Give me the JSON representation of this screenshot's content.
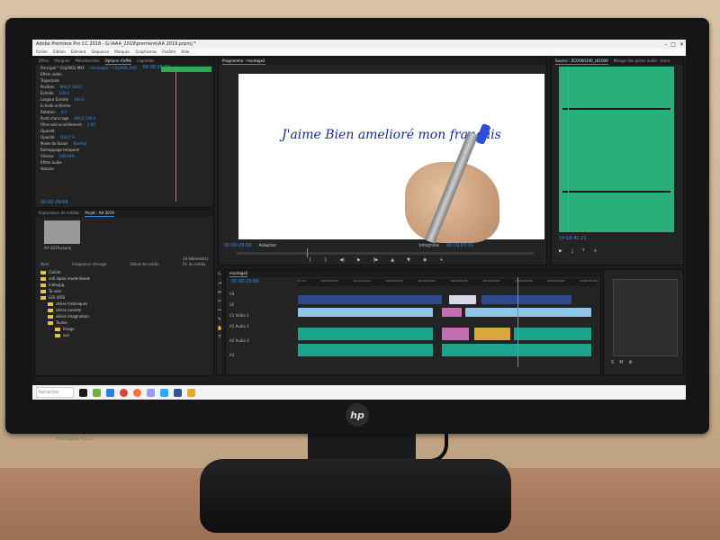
{
  "window": {
    "title": "Adobe Premiere Pro CC 2018 - G:\\AAA_2019\\premiere\\AA 2019.prproj *",
    "controls": [
      "–",
      "□",
      "✕"
    ]
  },
  "menu": [
    "Fichier",
    "Edition",
    "Elément",
    "Séquence",
    "Marques",
    "Graphismes",
    "Fenêtre",
    "Aide"
  ],
  "effect_controls": {
    "tabs": [
      "Effets",
      "Marques",
      "Métadonnées",
      "Options d'effet",
      "Légendes"
    ],
    "active_tab": "Options d'effet",
    "clip_label": "Principal * Clip0001.MXF",
    "seq_label": "montage2 * Clip0001.MXF",
    "timecode_start": "00:00:15:00",
    "section_video": "Effets vidéo",
    "rows": [
      {
        "label": "Trajectoire",
        "value": ""
      },
      {
        "label": "Position",
        "value": "960,0   540,0"
      },
      {
        "label": "Echelle",
        "value": "100,0"
      },
      {
        "label": "Largeur Echelle",
        "value": "100,0"
      },
      {
        "label": "Echelle uniforme",
        "value": ""
      },
      {
        "label": "Rotation",
        "value": "0,0"
      },
      {
        "label": "Point d'ancrage",
        "value": "960,0   540,0"
      },
      {
        "label": "Filtre anti-scintillement",
        "value": "0,00"
      },
      {
        "label": "Opacité",
        "value": ""
      },
      {
        "label": "Opacité",
        "value": "100,0 %"
      },
      {
        "label": "Mode de fusion",
        "value": "Normal"
      },
      {
        "label": "Remappage temporel",
        "value": ""
      },
      {
        "label": "Vitesse",
        "value": "100,00%"
      },
      {
        "label": "Effets audio",
        "value": ""
      },
      {
        "label": "Volume",
        "value": ""
      }
    ],
    "current_time": "00:00:29:06"
  },
  "program_monitor": {
    "tab_label": "Programme : montage2",
    "handwritten_text": "J'aime Bien amelioré mon français",
    "timecode_left": "00:00:29:06",
    "fit_label": "Adapter",
    "quality_label": "Intégrale",
    "timecode_right": "00:19:03:01"
  },
  "source_monitor": {
    "tabs": [
      "Source : ZCO060330_LK1000",
      "Mixage des pistes audio : mont"
    ],
    "timecode": "14:18:41:21",
    "wave_color": "#2bb07d"
  },
  "project_panel": {
    "tabs": [
      "Explorateur de médias",
      "Projet : AA 2019"
    ],
    "project_file": "AA 2019.prproj",
    "item_count": "24 élément(s)",
    "columns": [
      "Nom",
      "Fréquence d'image",
      "Début du média",
      "Fin du média"
    ],
    "items": [
      {
        "label": "Civilim",
        "indent": 0
      },
      {
        "label": "vidi alpha modernbook",
        "indent": 0
      },
      {
        "label": "Indexjpg",
        "indent": 0
      },
      {
        "label": "Ta voie",
        "indent": 0
      },
      {
        "label": "LES VIDS",
        "indent": 0
      },
      {
        "label": "séries historiques",
        "indent": 1
      },
      {
        "label": "séries ouverts",
        "indent": 1
      },
      {
        "label": "séries imagination",
        "indent": 1
      },
      {
        "label": "Toutes",
        "indent": 1
      },
      {
        "label": "Image",
        "indent": 2
      },
      {
        "label": "son",
        "indent": 2
      }
    ]
  },
  "timeline": {
    "tab_label": "montage2",
    "timecode": "00:00:29:06",
    "ruler_marks": [
      "00:00",
      "00:00:05:00",
      "00:00:10:00",
      "00:00:15:00",
      "00:00:20:00",
      "00:00:25:00",
      "00:00:30:00",
      "00:00:35:00",
      "00:00:40:00",
      "00:00:45:00"
    ],
    "tracks": [
      "V3",
      "V2",
      "V1",
      "A1",
      "A2",
      "A3"
    ],
    "track_names": [
      "Vidéo 1",
      "Audio 1",
      "Audio 2"
    ]
  },
  "taskbar": {
    "search_placeholder": "Rechercher",
    "icons": [
      "start-icon",
      "netflix-icon",
      "app-icon",
      "chrome-icon",
      "firefox-icon",
      "explorer-icon",
      "premiere-icon",
      "photoshop-icon",
      "word-icon"
    ]
  },
  "monitor": {
    "brand": "hp",
    "model": "ProDisplay P221"
  }
}
